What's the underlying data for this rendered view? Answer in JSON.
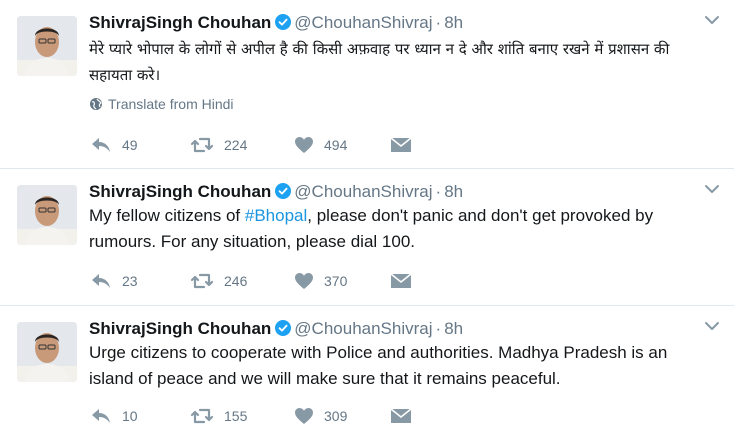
{
  "tweets": [
    {
      "name": "ShivrajSingh Chouhan",
      "handle": "@ChouhanShivraj",
      "separator": "·",
      "time": "8h",
      "text": "मेरे प्यारे भोपाल के लोगों से अपील है की किसी अफ़वाह पर ध्यान न दे और शांति बनाए रखने में प्रशासन की सहायता करे।",
      "translate_label": "Translate from Hindi",
      "replies": "49",
      "retweets": "224",
      "likes": "494"
    },
    {
      "name": "ShivrajSingh Chouhan",
      "handle": "@ChouhanShivraj",
      "separator": "·",
      "time": "8h",
      "text_before": "My fellow citizens of ",
      "hashtag": "#Bhopal",
      "text_after": ", please don't panic and don't get provoked by rumours. For any situation, please dial 100.",
      "replies": "23",
      "retweets": "246",
      "likes": "370"
    },
    {
      "name": "ShivrajSingh Chouhan",
      "handle": "@ChouhanShivraj",
      "separator": "·",
      "time": "8h",
      "text": "Urge citizens to cooperate with Police and authorities. Madhya Pradesh is an island of peace and we will make sure that it remains peaceful.",
      "replies": "10",
      "retweets": "155",
      "likes": "309"
    }
  ],
  "colors": {
    "text": "#14171a",
    "secondary": "#657786",
    "link": "#1b95e0",
    "verified": "#1da1f2",
    "divider": "#e1e8ed"
  },
  "icons": [
    "verified-badge-icon",
    "chevron-down-icon",
    "globe-icon",
    "reply-icon",
    "retweet-icon",
    "heart-icon",
    "direct-message-icon"
  ]
}
